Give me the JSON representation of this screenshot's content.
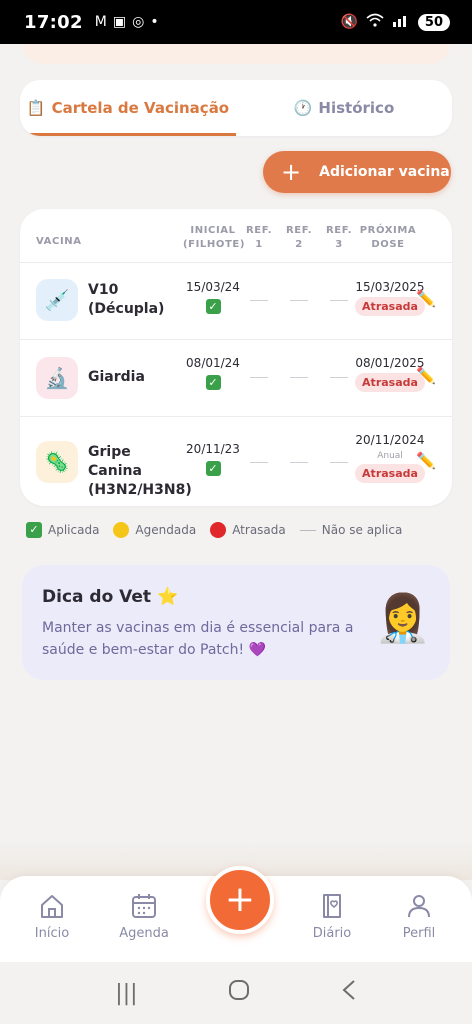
{
  "status": {
    "time": "17:02",
    "battery": "50"
  },
  "tabs": [
    {
      "icon": "clipboard-icon",
      "label": "Cartela de Vacinação",
      "active": true
    },
    {
      "icon": "clock-icon",
      "label": "Histórico",
      "active": false
    }
  ],
  "add_button": {
    "label": "Adicionar vacina"
  },
  "table": {
    "headers": {
      "vaccine": "VACINA",
      "initial_1": "INICIAL",
      "initial_2": "(FILHOTE)",
      "ref1_1": "REF.",
      "ref1_2": "1",
      "ref2_1": "REF.",
      "ref2_2": "2",
      "ref3_1": "REF.",
      "ref3_2": "3",
      "next_1": "PRÓXIMA",
      "next_2": "DOSE"
    },
    "rows": [
      {
        "name": "V10 (Décupla)",
        "icon": "syringe-icon",
        "initial": "15/03/24",
        "next_date": "15/03/2025",
        "frequency": "",
        "status": "Atrasada"
      },
      {
        "name": "Giardia",
        "icon": "microscope-icon",
        "initial": "08/01/24",
        "next_date": "08/01/2025",
        "frequency": "",
        "status": "Atrasada"
      },
      {
        "name": "Gripe Canina (H3N2/H3N8)",
        "icon": "microbe-icon",
        "initial": "20/11/23",
        "next_date": "20/11/2024",
        "frequency": "Anual",
        "status": "Atrasada"
      }
    ]
  },
  "legend": {
    "applied": "Aplicada",
    "scheduled": "Agendada",
    "late": "Atrasada",
    "na": "Não se aplica"
  },
  "tip": {
    "title": "Dica do Vet ⭐",
    "text": "Manter as vacinas em dia é essencial para a saúde e bem-estar do Patch! 💜"
  },
  "bottom_nav": {
    "home": "Início",
    "agenda": "Agenda",
    "diary": "Diário",
    "profile": "Perfil"
  },
  "colors": {
    "accent": "#e07a4a",
    "fab": "#f26a35",
    "late_badge_bg": "#fbe3e3",
    "late_badge_text": "#c83a3a",
    "tip_bg": "#ecebfa"
  }
}
